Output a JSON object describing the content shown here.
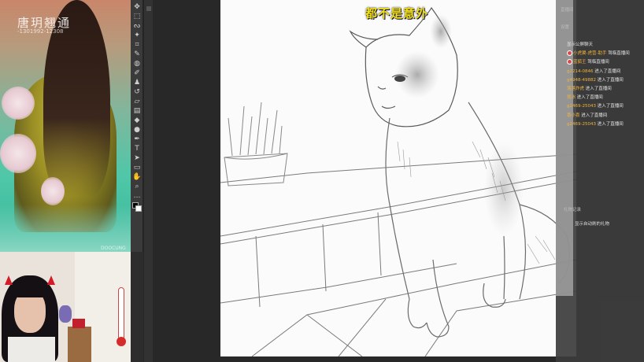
{
  "stream": {
    "title": "都不是意外"
  },
  "reference_image": {
    "watermark": "唐玥翘通",
    "watermark_sub": "-1301992-12308",
    "signature": "DOOCUNG"
  },
  "toolbar": {
    "tools": [
      {
        "icon": "move-icon",
        "glyph": "✥"
      },
      {
        "icon": "marquee-icon",
        "glyph": "⬚"
      },
      {
        "icon": "lasso-icon",
        "glyph": "ᔓ"
      },
      {
        "icon": "magic-wand-icon",
        "glyph": "✦"
      },
      {
        "icon": "crop-icon",
        "glyph": "⌗"
      },
      {
        "icon": "eyedropper-icon",
        "glyph": "✎"
      },
      {
        "icon": "healing-brush-icon",
        "glyph": "◍"
      },
      {
        "icon": "brush-icon",
        "glyph": "✐"
      },
      {
        "icon": "clone-stamp-icon",
        "glyph": "♟"
      },
      {
        "icon": "history-brush-icon",
        "glyph": "↺"
      },
      {
        "icon": "eraser-icon",
        "glyph": "▱"
      },
      {
        "icon": "gradient-icon",
        "glyph": "▤"
      },
      {
        "icon": "blur-icon",
        "glyph": "◆"
      },
      {
        "icon": "dodge-icon",
        "glyph": "●"
      },
      {
        "icon": "pen-icon",
        "glyph": "✒"
      },
      {
        "icon": "type-icon",
        "glyph": "T"
      },
      {
        "icon": "path-selection-icon",
        "glyph": "➤"
      },
      {
        "icon": "rectangle-icon",
        "glyph": "▭"
      },
      {
        "icon": "hand-icon",
        "glyph": "✋"
      },
      {
        "icon": "zoom-icon",
        "glyph": "⌕"
      },
      {
        "icon": "more-tools-icon",
        "glyph": "…"
      }
    ]
  },
  "chat": {
    "header_top": "直播间",
    "header_settings": "设置",
    "messages": [
      {
        "badge": false,
        "user": "",
        "text": "显示公屏聊天"
      },
      {
        "badge": true,
        "user": "小虎翼-虎营-助手",
        "text": "驾临直播间"
      },
      {
        "badge": true,
        "user": "蓝狐王",
        "text": "驾临直播间"
      },
      {
        "badge": false,
        "user": "g2214-0846",
        "text": "进入了直播间"
      },
      {
        "badge": false,
        "user": "g4948-49882",
        "text": "进入了直播间"
      },
      {
        "badge": false,
        "user": "落落炸虎",
        "text": "进入了直播间"
      },
      {
        "badge": false,
        "user": "昆冰",
        "text": "进入了直播间"
      },
      {
        "badge": false,
        "user": "g2469-25043",
        "text": "进入了直播间"
      },
      {
        "badge": false,
        "user": "喜小喜",
        "text": "进入了直播间"
      },
      {
        "badge": false,
        "user": "g2469-25043",
        "text": "进入了直播间"
      }
    ],
    "gift_section_title": "礼物记录",
    "gift_note": "显示自动刷的礼物"
  }
}
